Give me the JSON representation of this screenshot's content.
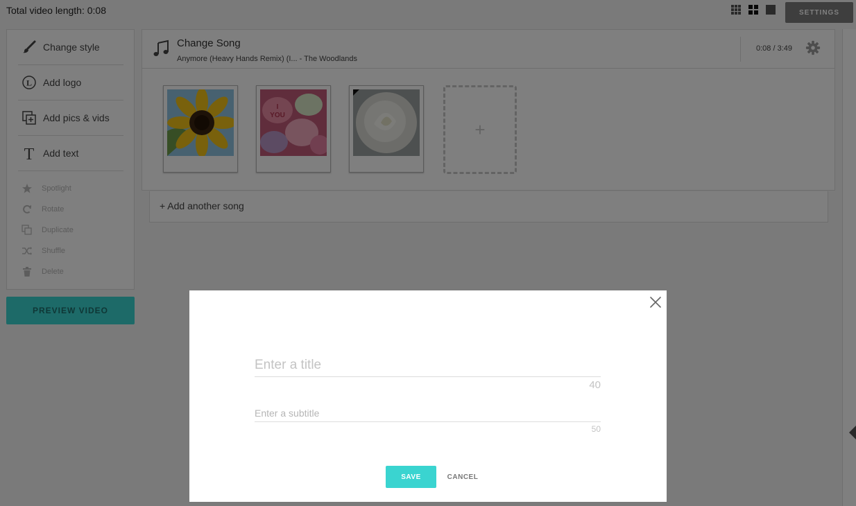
{
  "topbar": {
    "total_length": "Total video length: 0:08",
    "view_icons": [
      "grid-small-icon",
      "grid-large-icon",
      "single-view-icon"
    ],
    "settings_label": "SETTINGS"
  },
  "sidebar": {
    "items": [
      {
        "label": "Change style",
        "icon": "brush-icon"
      },
      {
        "label": "Add logo",
        "icon": "logo-icon"
      },
      {
        "label": "Add pics & vids",
        "icon": "add-media-icon"
      },
      {
        "label": "Add text",
        "icon": "text-icon"
      }
    ],
    "actions": [
      {
        "label": "Spotlight",
        "icon": "star-icon"
      },
      {
        "label": "Rotate",
        "icon": "rotate-icon"
      },
      {
        "label": "Duplicate",
        "icon": "duplicate-icon"
      },
      {
        "label": "Shuffle",
        "icon": "shuffle-icon"
      },
      {
        "label": "Delete",
        "icon": "trash-icon"
      }
    ]
  },
  "preview_label": "PREVIEW VIDEO",
  "song": {
    "title": "Change Song",
    "subtitle": "Anymore (Heavy Hands Remix) (I... - The Woodlands",
    "time": "0:08 / 3:49",
    "thumbnails": [
      "sunflower",
      "candy hearts",
      "white rose"
    ],
    "add_slot_symbol": "+"
  },
  "add_song_label": "+ Add another song",
  "modal": {
    "title_placeholder": "Enter a title",
    "title_value": "",
    "title_counter": "40",
    "subtitle_placeholder": "Enter a subtitle",
    "subtitle_value": "",
    "subtitle_counter": "50",
    "save_label": "SAVE",
    "cancel_label": "CANCEL"
  },
  "colors": {
    "accent": "#3ad4d0",
    "settings_button": "#7c7c7c",
    "overlay": "rgba(0,0,0,0.5)"
  }
}
